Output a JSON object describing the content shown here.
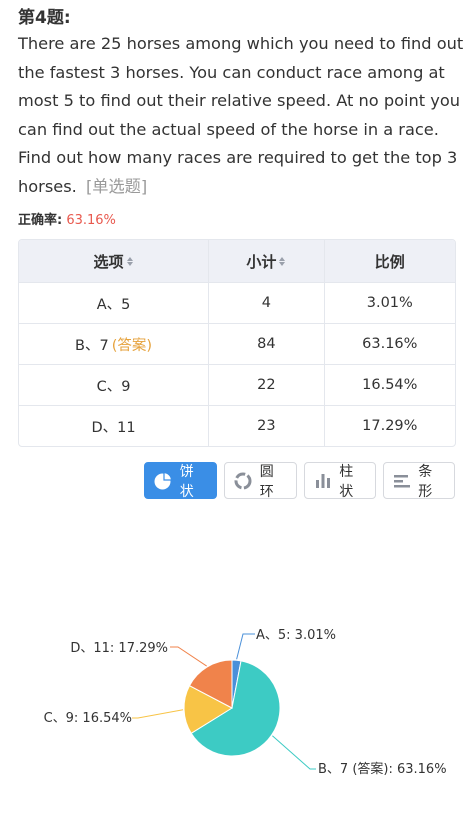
{
  "question": {
    "number": "第4题:",
    "text": "There are 25 horses among which you need to find out the fastest 3 horses. You can conduct race among at most 5 to find out their relative speed. At no point you can find out the actual speed of the horse in a race. Find out how many races are required to get the top 3 horses.",
    "type_tag": "[单选题]"
  },
  "accuracy": {
    "label": "正确率:",
    "value": "63.16%"
  },
  "table": {
    "headers": [
      "选项",
      "小计",
      "比例"
    ],
    "rows": [
      {
        "option": "A、5",
        "tag": "",
        "count": "4",
        "ratio": "3.01%"
      },
      {
        "option": "B、7",
        "tag": "(答案)",
        "count": "84",
        "ratio": "63.16%"
      },
      {
        "option": "C、9",
        "tag": "",
        "count": "22",
        "ratio": "16.54%"
      },
      {
        "option": "D、11",
        "tag": "",
        "count": "23",
        "ratio": "17.29%"
      }
    ]
  },
  "chart_tabs": [
    {
      "label": "饼状",
      "icon": "pie-chart-icon",
      "active": true
    },
    {
      "label": "圆环",
      "icon": "ring-chart-icon",
      "active": false
    },
    {
      "label": "柱状",
      "icon": "bar-chart-icon",
      "active": false
    },
    {
      "label": "条形",
      "icon": "strip-chart-icon",
      "active": false
    }
  ],
  "colors": {
    "accent": "#3a8ee6",
    "answer": "#e6a23c",
    "accuracy": "#e8594e"
  },
  "chart_data": {
    "type": "pie",
    "slices": [
      {
        "label": "A、5: 3.01%",
        "value": 3.01,
        "color": "#4a90d9"
      },
      {
        "label": "B、7 (答案): 63.16%",
        "value": 63.16,
        "color": "#3dcbc4"
      },
      {
        "label": "C、9: 16.54%",
        "value": 16.54,
        "color": "#f8c446"
      },
      {
        "label": "D、11: 17.29%",
        "value": 17.29,
        "color": "#f0834b"
      }
    ]
  }
}
